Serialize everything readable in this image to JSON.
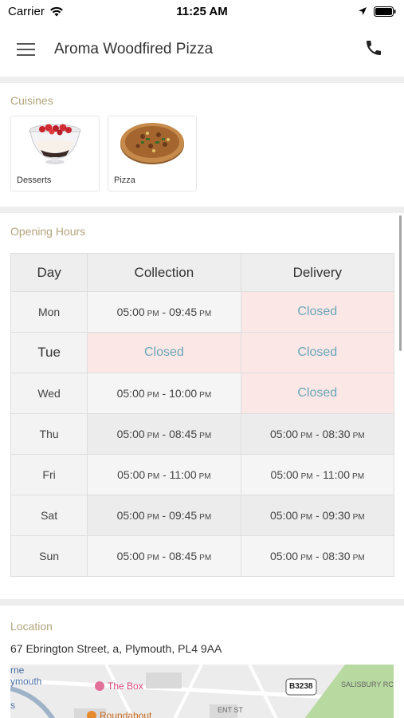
{
  "status_bar": {
    "carrier": "Carrier",
    "time": "11:25 AM"
  },
  "nav": {
    "title": "Aroma Woodfired Pizza"
  },
  "cuisines": {
    "heading": "Cuisines",
    "items": [
      {
        "label": "Desserts",
        "icon": "dessert-bowl-image"
      },
      {
        "label": "Pizza",
        "icon": "pizza-image"
      }
    ]
  },
  "opening_hours": {
    "heading": "Opening Hours",
    "columns": [
      "Day",
      "Collection",
      "Delivery"
    ],
    "rows": [
      {
        "day": "Mon",
        "collection": {
          "from": "05:00",
          "from_ampm": "PM",
          "to": "09:45",
          "to_ampm": "PM"
        },
        "delivery": "Closed"
      },
      {
        "day": "Tue",
        "collection": "Closed",
        "delivery": "Closed"
      },
      {
        "day": "Wed",
        "collection": {
          "from": "05:00",
          "from_ampm": "PM",
          "to": "10:00",
          "to_ampm": "PM"
        },
        "delivery": "Closed"
      },
      {
        "day": "Thu",
        "collection": {
          "from": "05:00",
          "from_ampm": "PM",
          "to": "08:45",
          "to_ampm": "PM"
        },
        "delivery": {
          "from": "05:00",
          "from_ampm": "PM",
          "to": "08:30",
          "to_ampm": "PM"
        }
      },
      {
        "day": "Fri",
        "collection": {
          "from": "05:00",
          "from_ampm": "PM",
          "to": "11:00",
          "to_ampm": "PM"
        },
        "delivery": {
          "from": "05:00",
          "from_ampm": "PM",
          "to": "11:00",
          "to_ampm": "PM"
        }
      },
      {
        "day": "Sat",
        "collection": {
          "from": "05:00",
          "from_ampm": "PM",
          "to": "09:45",
          "to_ampm": "PM"
        },
        "delivery": {
          "from": "05:00",
          "from_ampm": "PM",
          "to": "09:30",
          "to_ampm": "PM"
        }
      },
      {
        "day": "Sun",
        "collection": {
          "from": "05:00",
          "from_ampm": "PM",
          "to": "08:45",
          "to_ampm": "PM"
        },
        "delivery": {
          "from": "05:00",
          "from_ampm": "PM",
          "to": "08:30",
          "to_ampm": "PM"
        }
      }
    ],
    "today": "Tue"
  },
  "location": {
    "heading": "Location",
    "address": "67 Ebrington Street, a, Plymouth, PL4 9AA",
    "map_labels": [
      "rne",
      "ymouth",
      "The Box",
      "B3238",
      "SALISBURY RC",
      "s",
      "Roundabout",
      "ENT ST"
    ]
  },
  "colors": {
    "accent_label": "#b3a47c",
    "closed_text": "#6aa6b6",
    "closed_bg": "#fce7e7"
  }
}
